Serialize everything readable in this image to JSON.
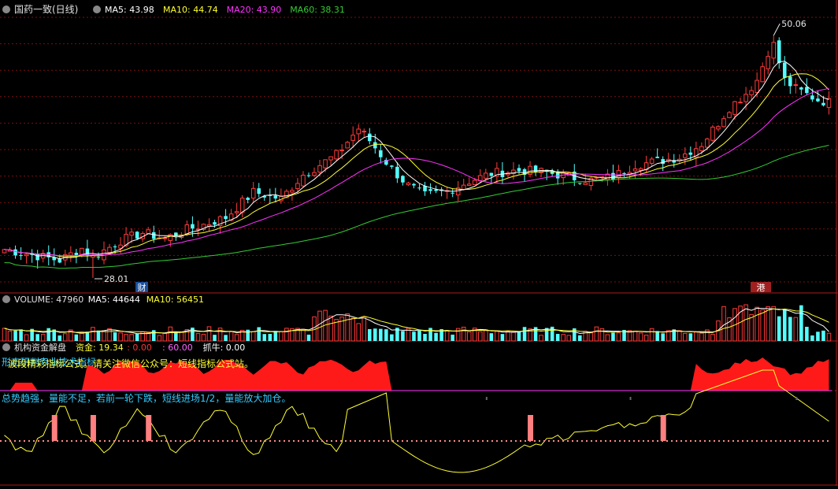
{
  "main_panel": {
    "stock_name": "国药一致(日线)",
    "ma_labels": [
      {
        "text": "MA5: 43.98",
        "color": "#ffffff"
      },
      {
        "text": "MA10: 44.74",
        "color": "#ffff33"
      },
      {
        "text": "MA20: 43.90",
        "color": "#ff33ff"
      },
      {
        "text": "MA60: 38.31",
        "color": "#33cc33"
      }
    ],
    "high_label": "50.06",
    "low_label": "28.01",
    "markers": [
      {
        "text": "财",
        "type": "blue"
      },
      {
        "text": "港",
        "type": "red"
      }
    ]
  },
  "volume_panel": {
    "title": "VOLUME: 47960",
    "ma_labels": [
      {
        "text": "MA5: 44644",
        "color": "#ffffff"
      },
      {
        "text": "MA10: 56451",
        "color": "#ffff33"
      }
    ]
  },
  "indicator_panel": {
    "title": "机构资金解盘",
    "labels": [
      {
        "text": "资金: 19.34",
        "color": "#ffff33"
      },
      {
        "text": ": 0.00",
        "color": "#ff3333"
      },
      {
        "text": ": 60.00",
        "color": "#ff66ff"
      },
      {
        "text": "抓牛: 0.00",
        "color": "#ffffff"
      }
    ],
    "overlay_lines": [
      {
        "text": "形态研判专业技术指标",
        "color": "#33ccff"
      },
      {
        "text": "波段精彩指标公式。请关注微信公众号：短线指标公式站。",
        "color": "#ffff33"
      },
      {
        "text": "总势趋强，量能不足，若前一轮下跌，短线进场1/2，量能放大加仓。",
        "color": "#33ccff"
      }
    ]
  },
  "chart_data": [
    {
      "type": "candlestick",
      "title": "国药一致(日线)",
      "ylim": [
        27.0,
        51.5
      ],
      "series_ma": [
        {
          "name": "MA5",
          "color": "#ffffff"
        },
        {
          "name": "MA10",
          "color": "#ffff33"
        },
        {
          "name": "MA20",
          "color": "#ff33ff"
        },
        {
          "name": "MA60",
          "color": "#33cc33"
        }
      ],
      "anchors_close": [
        [
          0,
          30.6
        ],
        [
          6,
          30.0
        ],
        [
          10,
          29.6
        ],
        [
          14,
          30.7
        ],
        [
          16,
          29.9
        ],
        [
          21,
          31.4
        ],
        [
          25,
          32.1
        ],
        [
          29,
          31.6
        ],
        [
          33,
          32.4
        ],
        [
          37,
          33.0
        ],
        [
          40,
          33.5
        ],
        [
          45,
          35.8
        ],
        [
          50,
          35.2
        ],
        [
          54,
          37.4
        ],
        [
          60,
          39.2
        ],
        [
          64,
          41.6
        ],
        [
          66,
          40.5
        ],
        [
          70,
          37.9
        ],
        [
          73,
          36.4
        ],
        [
          76,
          35.5
        ],
        [
          80,
          35.9
        ],
        [
          84,
          36.8
        ],
        [
          88,
          37.5
        ],
        [
          93,
          37.8
        ],
        [
          98,
          37.6
        ],
        [
          103,
          37.1
        ],
        [
          106,
          36.9
        ],
        [
          110,
          37.2
        ],
        [
          114,
          38.3
        ],
        [
          118,
          38.6
        ],
        [
          122,
          39.0
        ],
        [
          126,
          40.2
        ],
        [
          129,
          42.1
        ],
        [
          131,
          43.5
        ],
        [
          134,
          44.8
        ],
        [
          136,
          46.0
        ],
        [
          138,
          48.6
        ],
        [
          139,
          49.2
        ],
        [
          141,
          46.0
        ],
        [
          143,
          45.2
        ],
        [
          145,
          44.7
        ],
        [
          147,
          44.2
        ],
        [
          149,
          43.98
        ]
      ]
    },
    {
      "type": "bar",
      "title": "VOLUME",
      "last_value": 47960,
      "ma5_last": 44644,
      "ma10_last": 56451
    },
    {
      "type": "area",
      "title": "机构资金解盘",
      "values": {
        "资金": 19.34,
        "抓牛": 0.0
      },
      "reference_lines": [
        0.0,
        60.0
      ]
    }
  ]
}
